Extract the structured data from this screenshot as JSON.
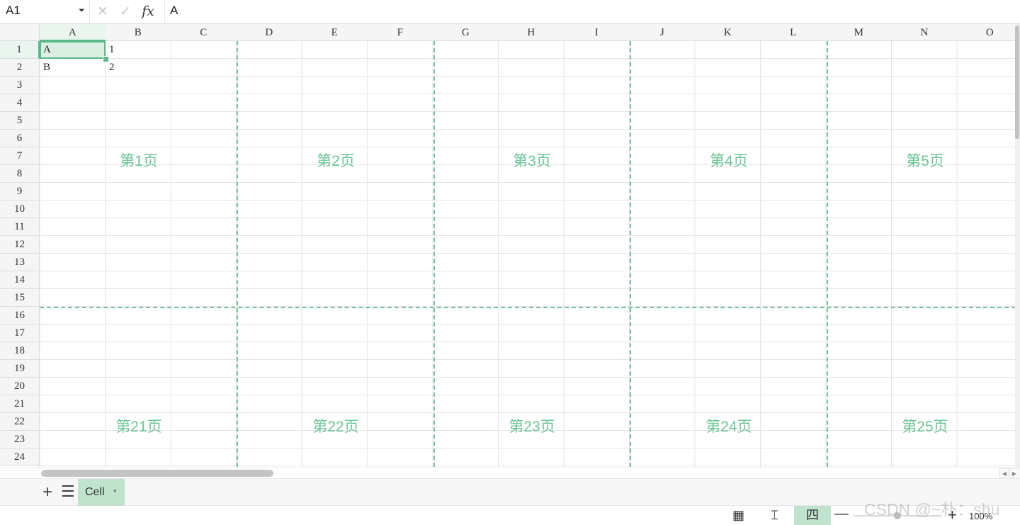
{
  "formula_bar": {
    "name_box": "A1",
    "name_box_caret": "⏷",
    "cancel_icon": "✕",
    "confirm_icon": "✓",
    "fx_label": "fx",
    "value": "A"
  },
  "columns": [
    "A",
    "B",
    "C",
    "D",
    "E",
    "F",
    "G",
    "H",
    "I",
    "J",
    "K",
    "L",
    "M",
    "N",
    "O"
  ],
  "rows": [
    "1",
    "2",
    "3",
    "4",
    "5",
    "6",
    "7",
    "8",
    "9",
    "10",
    "11",
    "12",
    "13",
    "14",
    "15",
    "16",
    "17",
    "18",
    "19",
    "20",
    "21",
    "22",
    "23",
    "24"
  ],
  "cells": {
    "A1": "A",
    "B1": "1",
    "A2": "B",
    "B2": "2"
  },
  "page_labels_top": [
    "第1页",
    "第2页",
    "第3页",
    "第4页",
    "第5页"
  ],
  "page_labels_bottom": [
    "第21页",
    "第22页",
    "第23页",
    "第24页",
    "第25页"
  ],
  "sheet_bar": {
    "add_icon": "+",
    "list_icon": "☰",
    "active_sheet": "Cell",
    "dropdown_icon": "▾"
  },
  "status_bar": {
    "normal_view_icon": "▦",
    "page_break_icon": "⌶",
    "page_layout_icon": "四",
    "zoom_out_icon": "—",
    "zoom_in_icon": "+",
    "zoom_level": "100%",
    "zoom_fraction": 0.5
  },
  "watermark": "CSDN @~朴：shu",
  "colors": {
    "accent": "#5cb88a",
    "page_break": "#72c29a",
    "page_label": "#6cc497",
    "selected_tab": "#bfe3cd"
  }
}
